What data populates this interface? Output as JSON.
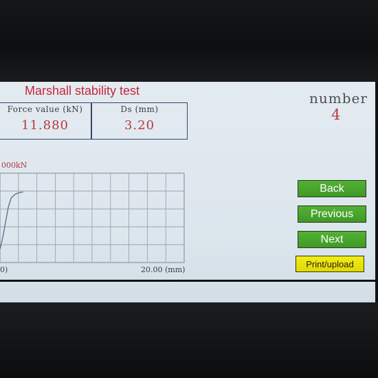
{
  "screen": {
    "title": "Marshall stability test",
    "force": {
      "label": "Force value (kN)",
      "value": "11.880"
    },
    "ds": {
      "label": "Ds (mm)",
      "value": "3.20"
    },
    "number": {
      "label": "number",
      "value": "4"
    }
  },
  "chart_data": {
    "type": "line",
    "y_axis_label": "000kN",
    "x_axis_min_label": "0)",
    "x_axis_max_label": "20.00 (mm)",
    "xlim": [
      0,
      20
    ],
    "grid": true,
    "series": [
      {
        "x": [
          0.0,
          0.3,
          0.6,
          0.9,
          1.2,
          1.6,
          2.0,
          2.5
        ],
        "y": [
          0.15,
          0.28,
          0.45,
          0.62,
          0.72,
          0.76,
          0.78,
          0.79
        ]
      }
    ]
  },
  "buttons": {
    "back": "Back",
    "previous": "Previous",
    "next": "Next",
    "print": "Print/upload"
  }
}
